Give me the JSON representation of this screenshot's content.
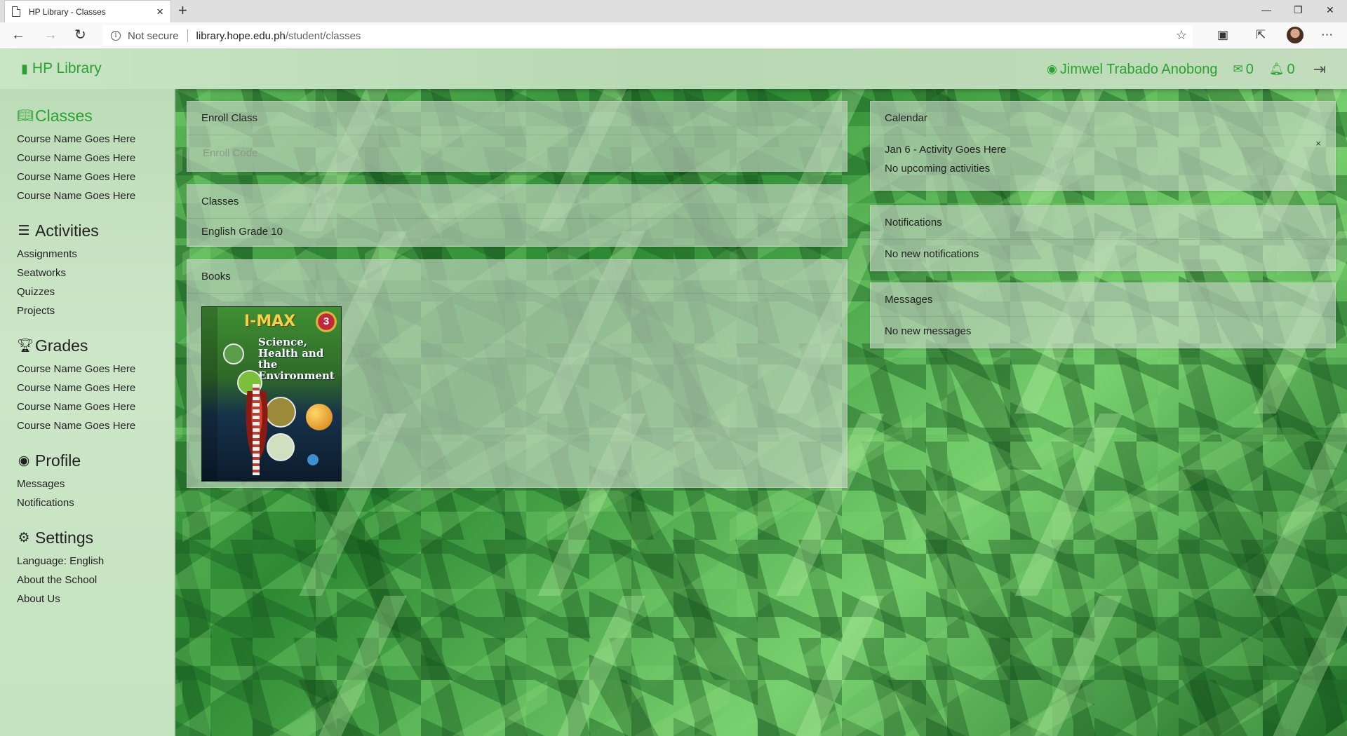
{
  "browser": {
    "tab_title": "HP Library - Classes",
    "tab_close": "×",
    "new_tab": "+",
    "minimize": "—",
    "restore": "❐",
    "window_close": "✕",
    "security_label": "Not secure",
    "url_host": "library.hope.edu.ph",
    "url_path": "/student/classes"
  },
  "navbar": {
    "brand": "HP Library",
    "user_name": "Jimwel Trabado Anobong",
    "messages_count": "0",
    "notifications_count": "0",
    "accent_color": "#2ca132"
  },
  "sidebar": {
    "classes": {
      "heading": "Classes",
      "icon": "book-open-icon",
      "items": [
        "Course Name Goes Here",
        "Course Name Goes Here",
        "Course Name Goes Here",
        "Course Name Goes Here"
      ]
    },
    "activities": {
      "heading": "Activities",
      "icon": "list-icon",
      "items": [
        "Assignments",
        "Seatworks",
        "Quizzes",
        "Projects"
      ]
    },
    "grades": {
      "heading": "Grades",
      "icon": "trophy-icon",
      "items": [
        "Course Name Goes Here",
        "Course Name Goes Here",
        "Course Name Goes Here",
        "Course Name Goes Here"
      ]
    },
    "profile": {
      "heading": "Profile",
      "icon": "user-circle-icon",
      "items": [
        "Messages",
        "Notifications"
      ]
    },
    "settings": {
      "heading": "Settings",
      "icon": "gear-icon",
      "items": [
        "Language: English",
        "About the School",
        "About Us"
      ]
    }
  },
  "main": {
    "enroll": {
      "title": "Enroll Class",
      "placeholder": "Enroll Code",
      "value": ""
    },
    "classes": {
      "title": "Classes",
      "items": [
        "English Grade 10"
      ]
    },
    "books": {
      "title": "Books",
      "items": [
        {
          "cover_brand": "I-MAX",
          "cover_grade": "3",
          "cover_title": "Science, Health and the Environment"
        }
      ]
    }
  },
  "right": {
    "calendar": {
      "title": "Calendar",
      "event": "Jan 6 - Activity Goes Here",
      "empty": "No upcoming activities",
      "close": "×"
    },
    "notifications": {
      "title": "Notifications",
      "empty": "No new notifications"
    },
    "messages": {
      "title": "Messages",
      "empty": "No new messages"
    }
  }
}
